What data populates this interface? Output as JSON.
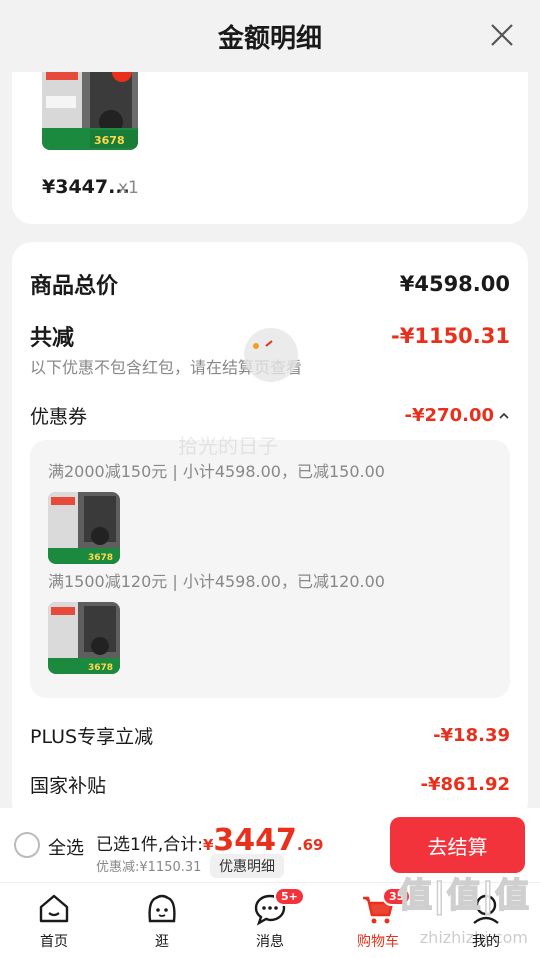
{
  "header": {
    "title": "金额明细"
  },
  "product": {
    "price": "¥3447...",
    "qty": "x1"
  },
  "detail": {
    "total_label": "商品总价",
    "total_amount": "¥4598.00",
    "reduce_label": "共减",
    "reduce_amount": "-¥1150.31",
    "reduce_note": "以下优惠不包含红包，请在结算页查看",
    "coupon_label": "优惠券",
    "coupon_amount": "-¥270.00",
    "coupons": [
      {
        "text": "满2000减150元 | 小计4598.00，已减150.00"
      },
      {
        "text": "满1500减120元 | 小计4598.00，已减120.00"
      }
    ],
    "plus_label": "PLUS专享立减",
    "plus_amount": "-¥18.39",
    "subsidy_label": "国家补贴",
    "subsidy_amount": "-¥861.92"
  },
  "bottom": {
    "select_all": "全选",
    "selected": "已选1件,合计:",
    "total_sym": "¥",
    "total_int": "3447",
    "total_dec": ".69",
    "discount": "优惠减:¥1150.31",
    "detail_btn": "优惠明细",
    "checkout": "去结算"
  },
  "tabs": [
    {
      "label": "首页",
      "icon": "home-icon"
    },
    {
      "label": "逛",
      "icon": "face-icon"
    },
    {
      "label": "消息",
      "icon": "message-icon",
      "badge": "5+"
    },
    {
      "label": "购物车",
      "icon": "cart-icon",
      "badge": "35"
    },
    {
      "label": "我的",
      "icon": "profile-icon"
    }
  ],
  "overlay": {
    "watermark": "拾光的日子",
    "logo": "值|值|值",
    "url": "zhizhizhi.com"
  },
  "colors": {
    "accent": "#f3333b",
    "price_red": "#e8301c"
  }
}
